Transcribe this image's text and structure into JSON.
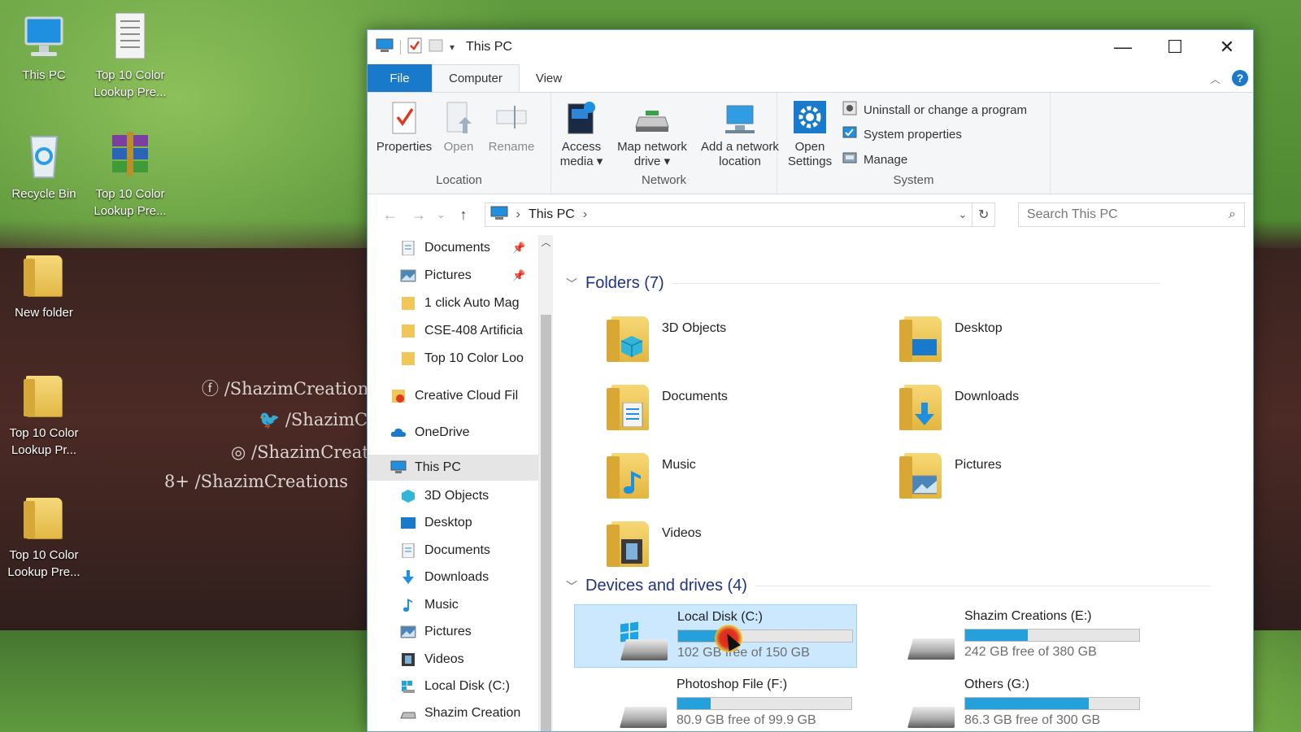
{
  "desktop": {
    "icons": [
      {
        "label": "This PC",
        "icon": "monitor-icon"
      },
      {
        "label": "Top 10 Color Lookup Pre...",
        "icon": "text-file-icon"
      },
      {
        "label": "Recycle Bin",
        "icon": "recycle-bin-icon"
      },
      {
        "label": "Top 10 Color Lookup Pre...",
        "icon": "winrar-archive-icon"
      },
      {
        "label": "New folder",
        "icon": "folder-icon"
      },
      {
        "label": "Top 10 Color Lookup Pr...",
        "icon": "folder-icon"
      },
      {
        "label": "Top 10 Color Lookup Pre...",
        "icon": "folder-icon"
      }
    ],
    "social": [
      "/ShazimCreations",
      "/ShazimCr",
      "/ShazimCreati",
      "/ShazimCreations"
    ]
  },
  "window": {
    "title": "This PC",
    "controls": {
      "minimize": "—",
      "maximize": "☐",
      "close": "✕"
    },
    "tabs": [
      "File",
      "Computer",
      "View"
    ],
    "active_tab": "Computer",
    "help": "?"
  },
  "ribbon": {
    "groups": {
      "location": {
        "label": "Location",
        "buttons": [
          {
            "label": "Properties",
            "enabled": true
          },
          {
            "label": "Open",
            "enabled": false
          },
          {
            "label": "Rename",
            "enabled": false
          }
        ]
      },
      "network": {
        "label": "Network",
        "buttons": [
          {
            "line1": "Access",
            "line2": "media ▾"
          },
          {
            "line1": "Map network",
            "line2": "drive ▾"
          },
          {
            "line1": "Add a network",
            "line2": "location"
          }
        ]
      },
      "system": {
        "label": "System",
        "open_settings": {
          "line1": "Open",
          "line2": "Settings"
        },
        "items": [
          "Uninstall or change a program",
          "System properties",
          "Manage"
        ]
      }
    }
  },
  "address": {
    "path": "This PC",
    "search_placeholder": "Search This PC"
  },
  "nav": {
    "items": [
      {
        "label": "Documents",
        "pinned": true
      },
      {
        "label": "Pictures",
        "pinned": true
      },
      {
        "label": "1 click Auto Mag"
      },
      {
        "label": "CSE-408 Artificia"
      },
      {
        "label": "Top 10 Color Loo"
      },
      {
        "label": "Creative Cloud Fil"
      },
      {
        "label": "OneDrive"
      },
      {
        "label": "This PC",
        "selected": true
      },
      {
        "label": "3D Objects"
      },
      {
        "label": "Desktop"
      },
      {
        "label": "Documents"
      },
      {
        "label": "Downloads"
      },
      {
        "label": "Music"
      },
      {
        "label": "Pictures"
      },
      {
        "label": "Videos"
      },
      {
        "label": "Local Disk (C:)"
      },
      {
        "label": "Shazim Creation"
      }
    ]
  },
  "folders": {
    "header": "Folders (7)",
    "items": [
      "3D Objects",
      "Desktop",
      "Documents",
      "Downloads",
      "Music",
      "Pictures",
      "Videos"
    ]
  },
  "drives": {
    "header": "Devices and drives (4)",
    "items": [
      {
        "name": "Local Disk (C:)",
        "free": "102 GB free of 150 GB",
        "used_fraction": 0.32,
        "selected": true
      },
      {
        "name": "Shazim Creations (E:)",
        "free": "242 GB free of 380 GB",
        "used_fraction": 0.36
      },
      {
        "name": "Photoshop File (F:)",
        "free": "80.9 GB free of 99.9 GB",
        "used_fraction": 0.19
      },
      {
        "name": "Others (G:)",
        "free": "86.3 GB free of 300 GB",
        "used_fraction": 0.71
      }
    ]
  },
  "colors": {
    "accent": "#1979ca",
    "bar": "#26a0da",
    "selection": "#cce8ff",
    "header": "#1e3287"
  }
}
